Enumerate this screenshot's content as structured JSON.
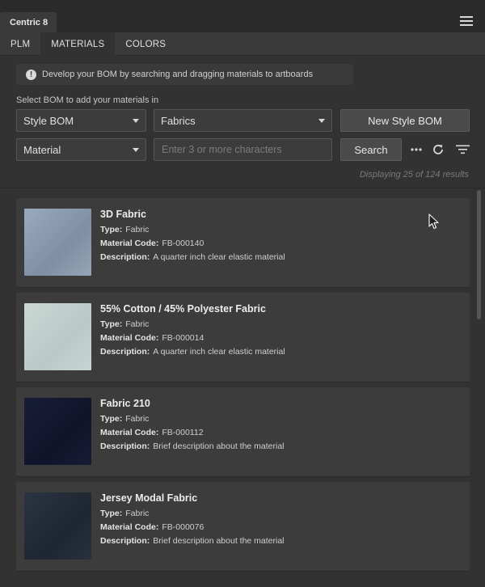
{
  "panel": {
    "title": "Centric 8"
  },
  "tabs": [
    {
      "label": "PLM"
    },
    {
      "label": "MATERIALS"
    },
    {
      "label": "COLORS"
    }
  ],
  "info": {
    "text": "Develop your BOM by searching and dragging materials to artboards"
  },
  "form": {
    "select_label": "Select BOM to add your materials in",
    "bom_select": "Style BOM",
    "category_select": "Fabrics",
    "new_bom_button": "New Style BOM",
    "type_select": "Material",
    "search_placeholder": "Enter 3 or more characters",
    "search_button": "Search"
  },
  "results": {
    "text": "Displaying 25 of 124 results"
  },
  "field_labels": {
    "type": "Type:",
    "code": "Material Code:",
    "description": "Description:"
  },
  "materials": [
    {
      "name": "3D Fabric",
      "type": "Fabric",
      "code": "FB-000140",
      "description": "A quarter inch clear elastic material",
      "swatch": "#8e9db0"
    },
    {
      "name": "55% Cotton / 45% Polyester Fabric",
      "type": "Fabric",
      "code": "FB-000014",
      "description": "A quarter inch clear elastic material",
      "swatch": "#c4d2cf"
    },
    {
      "name": "Fabric 210",
      "type": "Fabric",
      "code": "FB-000112",
      "description": "Brief description about the material",
      "swatch": "#141932"
    },
    {
      "name": "Jersey Modal Fabric",
      "type": "Fabric",
      "code": "FB-000076",
      "description": "Brief description about the material",
      "swatch": "#252d3a"
    }
  ]
}
